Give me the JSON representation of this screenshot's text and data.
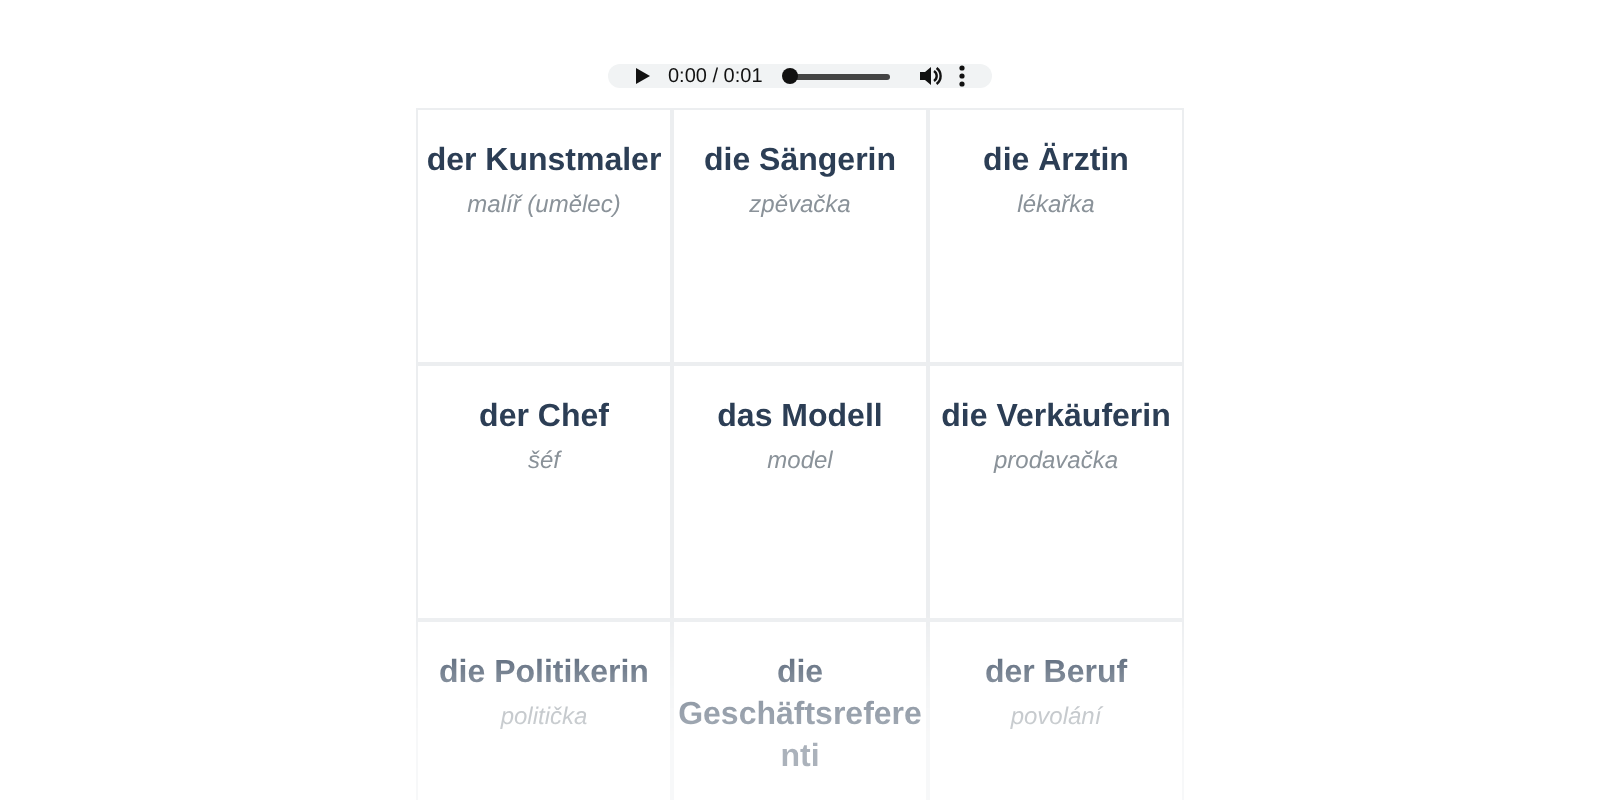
{
  "audio_player": {
    "time": "0:00 / 0:01",
    "level": 0
  },
  "cards": [
    {
      "word": "der Kunstmaler",
      "translation": "malíř (umělec)"
    },
    {
      "word": "die Sängerin",
      "translation": "zpěvačka"
    },
    {
      "word": "die Ärztin",
      "translation": "lékařka"
    },
    {
      "word": "der Chef",
      "translation": "šéf"
    },
    {
      "word": "das Modell",
      "translation": "model"
    },
    {
      "word": "die Verkäuferin",
      "translation": "prodavačka"
    },
    {
      "word": "die Politikerin",
      "translation": "politička"
    },
    {
      "word": "die Geschäftsreferenti"
    },
    {
      "word": "der Beruf",
      "translation": "povolání"
    }
  ]
}
